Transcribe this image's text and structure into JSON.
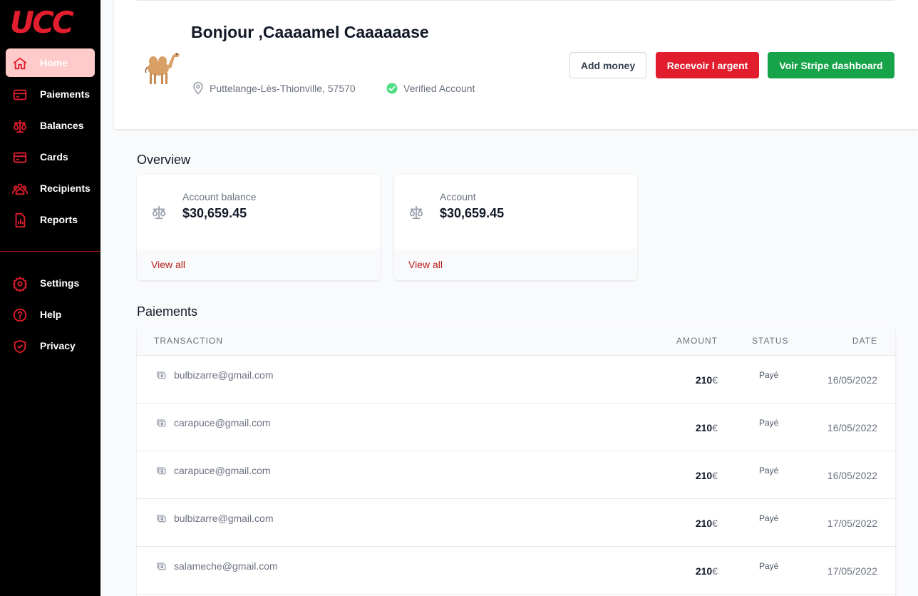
{
  "sidebar": {
    "logo": "UCC",
    "items": [
      {
        "label": "Home",
        "icon": "home-icon"
      },
      {
        "label": "Paiements",
        "icon": "credit-card-icon"
      },
      {
        "label": "Balances",
        "icon": "scale-icon"
      },
      {
        "label": "Cards",
        "icon": "credit-card-icon"
      },
      {
        "label": "Recipients",
        "icon": "user-group-icon"
      },
      {
        "label": "Reports",
        "icon": "document-report-icon"
      }
    ],
    "secondary": [
      {
        "label": "Settings",
        "icon": "gear-icon"
      },
      {
        "label": "Help",
        "icon": "question-circle-icon"
      },
      {
        "label": "Privacy",
        "icon": "shield-check-icon"
      }
    ]
  },
  "header": {
    "greeting": "Bonjour ,Caaaamel Caaaaaase",
    "location": "Puttelange-Lès-Thionville, 57570",
    "verified": "Verified Account",
    "buttons": {
      "add_money": "Add money",
      "receive": "Recevoir l argent",
      "stripe": "Voir Stripe dashboard"
    }
  },
  "overview": {
    "title": "Overview",
    "cards": [
      {
        "label": "Account balance",
        "value": "$30,659.45",
        "link": "View all"
      },
      {
        "label": "Account",
        "value": "$30,659.45",
        "link": "View all"
      }
    ]
  },
  "payments": {
    "title": "Paiements",
    "columns": {
      "transaction": "TRANSACTION",
      "amount": "AMOUNT",
      "status": "STATUS",
      "date": "DATE"
    },
    "rows": [
      {
        "email": "bulbizarre@gmail.com",
        "amount": "210",
        "currency": "€",
        "status": "Payé",
        "date": "16/05/2022"
      },
      {
        "email": "carapuce@gmail.com",
        "amount": "210",
        "currency": "€",
        "status": "Payé",
        "date": "16/05/2022"
      },
      {
        "email": "carapuce@gmail.com",
        "amount": "210",
        "currency": "€",
        "status": "Payé",
        "date": "16/05/2022"
      },
      {
        "email": "bulbizarre@gmail.com",
        "amount": "210",
        "currency": "€",
        "status": "Payé",
        "date": "17/05/2022"
      },
      {
        "email": "salameche@gmail.com",
        "amount": "210",
        "currency": "€",
        "status": "Payé",
        "date": "17/05/2022"
      }
    ]
  },
  "colors": {
    "brand_red": "#e11d2e",
    "active_bg": "#fecaca",
    "green": "#16a34a",
    "sidebar_bg": "#000000"
  }
}
